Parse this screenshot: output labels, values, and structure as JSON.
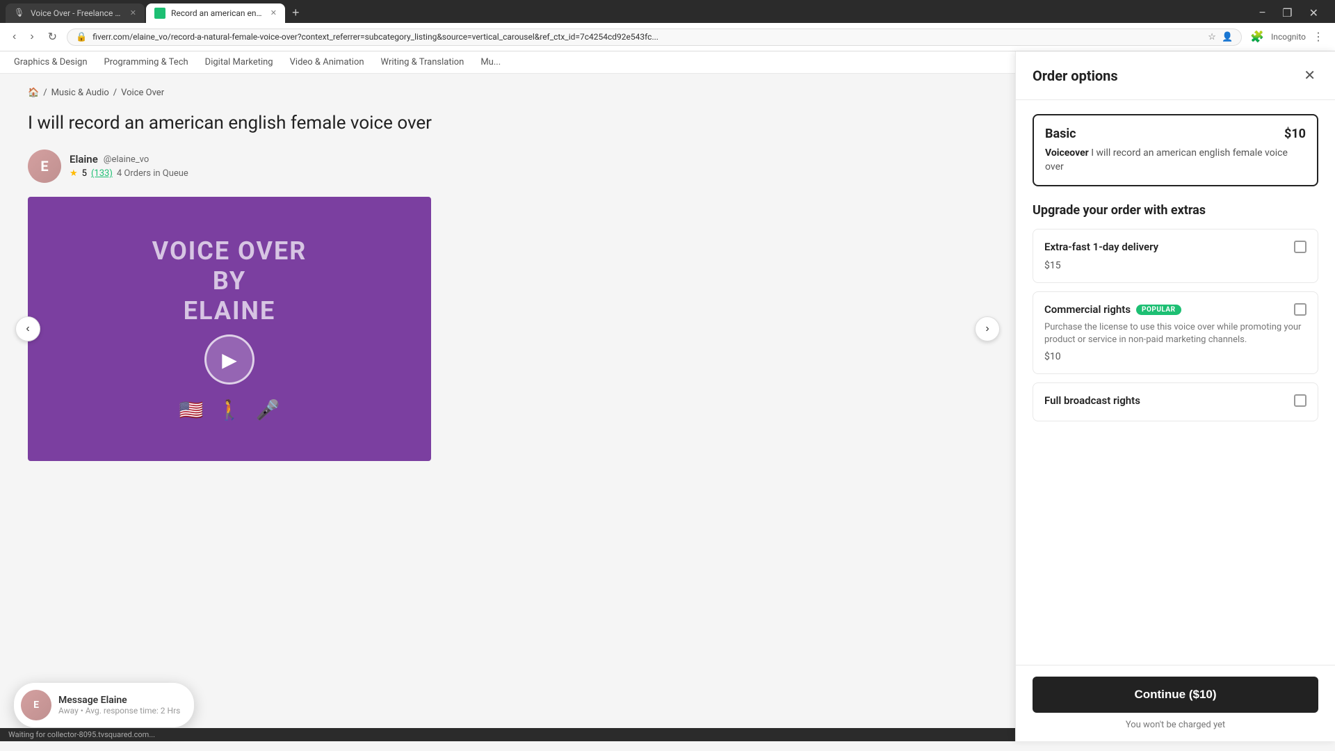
{
  "browser": {
    "tabs": [
      {
        "id": "tab1",
        "title": "Voice Over - Freelance Voice A...",
        "active": false,
        "favicon": "🎙"
      },
      {
        "id": "tab2",
        "title": "Record an american english fe...",
        "active": true,
        "favicon": "🟢"
      }
    ],
    "new_tab_label": "+",
    "address": "fiverr.com/elaine_vo/record-a-natural-female-voice-over?context_referrer=subcategory_listing&source=vertical_carousel&ref_ctx_id=7c4254cd92e543fc...",
    "nav_back": "‹",
    "nav_forward": "›",
    "nav_refresh": "↻",
    "incognito_label": "Incognito",
    "window_controls": {
      "minimize": "−",
      "maximize": "❐",
      "close": "✕"
    }
  },
  "site_nav": {
    "items": [
      "Graphics & Design",
      "Programming & Tech",
      "Digital Marketing",
      "Video & Animation",
      "Writing & Translation",
      "Mu..."
    ]
  },
  "breadcrumb": {
    "home": "🏠",
    "sep1": "/",
    "music": "Music & Audio",
    "sep2": "/",
    "category": "Voice Over"
  },
  "listing": {
    "title": "I will record an american english female voice over",
    "seller": {
      "name": "Elaine",
      "handle": "@elaine_vo",
      "rating": "5",
      "rating_count": "(133)",
      "orders_queue": "4 Orders in Queue",
      "avatar_initials": "E"
    },
    "media": {
      "text_line1": "VOICE OVER",
      "text_line2": "BY",
      "text_line3": "ELAINE",
      "play_icon": "▶"
    }
  },
  "message_bubble": {
    "label": "Message Elaine",
    "status": "Away  •  Avg. response time: 2 Hrs"
  },
  "order_panel": {
    "title": "Order options",
    "close_icon": "✕",
    "package": {
      "name": "Basic",
      "price": "$10",
      "desc_bold": "Voiceover",
      "desc_text": " I will record an american english female voice over"
    },
    "extras_title": "Upgrade your order with extras",
    "extras": [
      {
        "name": "Extra-fast 1-day delivery",
        "badge": null,
        "price": "$15",
        "desc": null
      },
      {
        "name": "Commercial rights",
        "badge": "POPULAR",
        "price": "$10",
        "desc": "Purchase the license to use this voice over while promoting your product or service in non-paid marketing channels."
      },
      {
        "name": "Full broadcast rights",
        "badge": null,
        "price": null,
        "desc": null
      }
    ],
    "continue_btn": "Continue ($10)",
    "no_charge": "You won't be charged yet"
  },
  "status_bar": {
    "text": "Waiting for collector-8095.tvsquared.com..."
  }
}
